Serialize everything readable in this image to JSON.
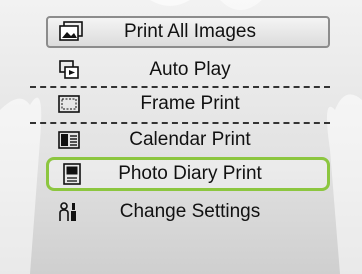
{
  "menu": {
    "items": [
      {
        "label": "Print All Images",
        "icon": "print-all-images-icon",
        "state": "highlighted"
      },
      {
        "label": "Auto Play",
        "icon": "auto-play-icon"
      },
      {
        "label": "Frame Print",
        "icon": "frame-print-icon"
      },
      {
        "label": "Calendar Print",
        "icon": "calendar-print-icon"
      },
      {
        "label": "Photo Diary Print",
        "icon": "photo-diary-print-icon",
        "state": "selected"
      },
      {
        "label": "Change Settings",
        "icon": "change-settings-icon"
      }
    ]
  },
  "colors": {
    "selection_border": "#8cc63f",
    "highlight_border": "#8c8c8c",
    "text": "#111111"
  }
}
